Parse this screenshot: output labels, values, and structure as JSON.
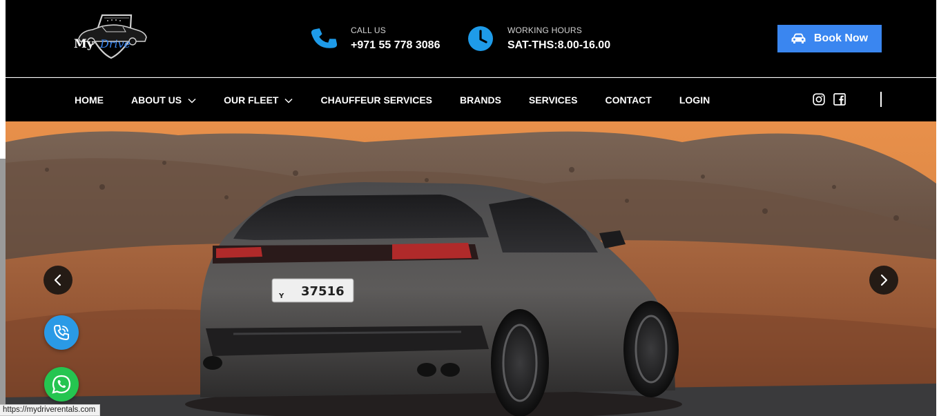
{
  "brand": {
    "logo_text_my": "My",
    "logo_text_drive": "Drive",
    "colors": {
      "accent": "#3a86f0",
      "phone_blue": "#1e9be9",
      "whatsapp_green": "#25c550",
      "header_bg": "#000000"
    }
  },
  "header": {
    "call": {
      "label": "CALL US",
      "value": "+971 55 778 3086",
      "icon": "phone-icon"
    },
    "hours": {
      "label": "WORKING HOURS",
      "value": "SAT-THS:8.00-16.00",
      "icon": "clock-icon"
    },
    "book_button": {
      "label": "Book Now",
      "icon": "car-icon"
    }
  },
  "nav": {
    "items": [
      {
        "label": "HOME",
        "has_dropdown": false
      },
      {
        "label": "ABOUT US",
        "has_dropdown": true
      },
      {
        "label": "OUR FLEET",
        "has_dropdown": true
      },
      {
        "label": "CHAUFFEUR SERVICES",
        "has_dropdown": false
      },
      {
        "label": "BRANDS",
        "has_dropdown": false
      },
      {
        "label": "SERVICES",
        "has_dropdown": false
      },
      {
        "label": "CONTACT",
        "has_dropdown": false
      },
      {
        "label": "LOGIN",
        "has_dropdown": false
      }
    ],
    "social": [
      "instagram-icon",
      "facebook-icon"
    ]
  },
  "hero": {
    "plate_code": "Y",
    "plate_number": "37516",
    "controls": [
      "chevron-left-icon",
      "chevron-right-icon"
    ]
  },
  "floating": [
    "phone-call-icon",
    "whatsapp-icon"
  ],
  "status_bar": {
    "url": "https://mydriverentals.com"
  }
}
